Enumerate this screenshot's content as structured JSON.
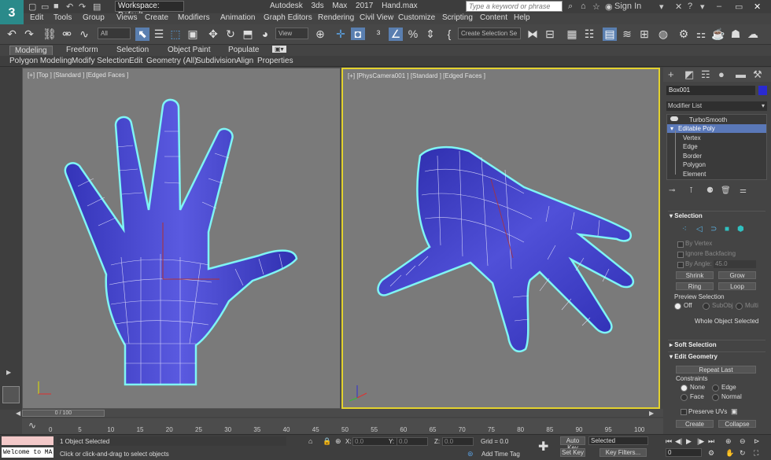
{
  "app": {
    "logo": "3",
    "workspace": "Workspace: Default",
    "title": "Autodesk 3ds Max 2017",
    "file": "Hand.max",
    "search_placeholder": "Type a keyword or phrase",
    "sign_in": "Sign In"
  },
  "menu": [
    "Edit",
    "Tools",
    "Group",
    "Views",
    "Create",
    "Modifiers",
    "Animation",
    "Graph Editors",
    "Rendering",
    "Civil View",
    "Customize",
    "Scripting",
    "Content",
    "Help"
  ],
  "toolbar": {
    "selection_filter": "All",
    "ref_coord": "View",
    "named_selection": "Create Selection Se"
  },
  "ribbon": {
    "tabs": [
      "Modeling",
      "Freeform",
      "Selection",
      "Object Paint",
      "Populate"
    ],
    "active_tab": "Modeling",
    "panels": [
      "Polygon Modeling",
      "Modify Selection",
      "Edit",
      "Geometry (All)",
      "Subdivision",
      "Align",
      "Properties"
    ]
  },
  "viewports": {
    "left_label": "[+] [Top ] [Standard ] [Edged Faces ]",
    "right_label": "[+] [PhysCamera001 ] [Standard ] [Edged Faces ]"
  },
  "command_panel": {
    "object_name": "Box001",
    "object_color": "#2a2ad0",
    "modifier_list": "Modifier List",
    "stack": [
      {
        "label": "TurboSmooth",
        "indent": 1
      },
      {
        "label": "Editable Poly",
        "indent": 0,
        "selected": true
      },
      {
        "label": "Vertex",
        "indent": 2
      },
      {
        "label": "Edge",
        "indent": 2
      },
      {
        "label": "Border",
        "indent": 2
      },
      {
        "label": "Polygon",
        "indent": 2
      },
      {
        "label": "Element",
        "indent": 2
      }
    ],
    "selection": {
      "header": "Selection",
      "by_vertex": "By Vertex",
      "ignore_backfacing": "Ignore Backfacing",
      "by_angle": "By Angle:",
      "angle_value": "45.0",
      "shrink": "Shrink",
      "grow": "Grow",
      "ring": "Ring",
      "loop": "Loop",
      "preview_selection": "Preview Selection",
      "off": "Off",
      "subobj": "SubObj",
      "multi": "Multi",
      "whole_object": "Whole Object Selected"
    },
    "soft_selection": "Soft Selection",
    "edit_geometry": {
      "header": "Edit Geometry",
      "repeat_last": "Repeat Last",
      "constraints": "Constraints",
      "none": "None",
      "edge": "Edge",
      "face": "Face",
      "normal": "Normal",
      "preserve_uvs": "Preserve UVs",
      "create": "Create",
      "collapse": "Collapse"
    }
  },
  "timeline": {
    "slider": "0 / 100",
    "ticks": [
      "0",
      "5",
      "10",
      "15",
      "20",
      "25",
      "30",
      "35",
      "40",
      "45",
      "50",
      "55",
      "60",
      "65",
      "70",
      "75",
      "80",
      "85",
      "90",
      "95",
      "100"
    ]
  },
  "status": {
    "maxscript": "Welcome to MA",
    "objects": "1 Object Selected",
    "prompt": "Click or click-and-drag to select objects",
    "x_label": "X:",
    "y_label": "Y:",
    "z_label": "Z:",
    "x_value": "0.0",
    "y_value": "0.0",
    "z_value": "0.0",
    "grid": "Grid = 0.0",
    "add_time_tag": "Add Time Tag",
    "auto_key": "Auto Key",
    "auto_key_mode": "Selected",
    "set_key": "Set Key",
    "key_filters": "Key Filters...",
    "frame": "0"
  }
}
